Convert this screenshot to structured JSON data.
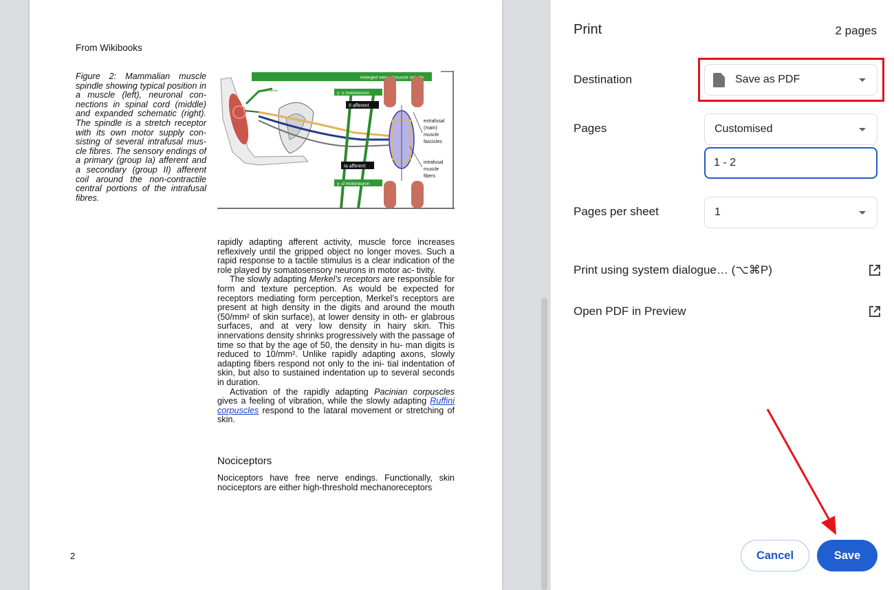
{
  "document": {
    "header": "From Wikibooks",
    "caption": "Figure 2: Mammalian muscle spindle showing typical position in a muscle (left), neuronal con- nections in spinal cord (middle) and expanded schematic (right). The spindle is a stretch receptor with its own motor supply con- sisting of several intrafusal mus- cle fibres. The sensory endings of a primary (group Ia) afferent and a secondary (group II) afferent coil around the non-contractile central portions of the intrafusal fibres.",
    "figure_labels": {
      "top_banner": "enlarged view of muscle spindle",
      "gamma_s": "γ -s motoneuron",
      "ii_afferent": "II afferent",
      "ia_afferent": "Ia afferent",
      "gamma_d": "γ -d motoneuron",
      "extrafusal": [
        "extrafusal",
        "(main)",
        "muscle",
        "fascicles"
      ],
      "intrafusal": [
        "intrafusal",
        "muscle",
        "fibers"
      ],
      "muscle_spindle": "muscle spindle"
    },
    "para1": "rapidly adapting afferent activity, muscle force increases reflexively until the gripped object no longer moves. Such a rapid response to a tactile stimulus is a clear indication of the role played by somatosensory neurons in motor ac- tivity.",
    "para2_before": "The slowly adapting ",
    "para2_italic": "Merkel’s receptors",
    "para2_after": " are responsible for form and texture perception. As would be expected for receptors mediating form perception, Merkel’s receptors are present at high density in the digits and around the mouth (50/mm² of skin surface), at lower density in oth- er glabrous surfaces, and at very low density in hairy skin. This innervations density shrinks progressively with the passage of time so that by the age of 50, the density in hu- man digits is reduced to 10/mm². Unlike rapidly adapting axons, slowly adapting fibers respond not only to the ini- tial indentation of skin, but also to sustained indentation up to several seconds in duration.",
    "para3_before": "Activation of the rapidly adapting ",
    "para3_italic": "Pacinian corpuscles",
    "para3_mid": " gives a feeling of vibration, while the slowly adapting ",
    "para3_link": "Ruffini corpuscles",
    "para3_after": " respond to the lataral movement or stretching of skin.",
    "section_heading": "Nociceptors",
    "section_text": "Nociceptors have free nerve endings. Functionally, skin nociceptors are either high-threshold mechanoreceptors",
    "page_number": "2"
  },
  "panel": {
    "title": "Print",
    "page_count": "2 pages",
    "destination_label": "Destination",
    "destination_value": "Save as PDF",
    "pages_label": "Pages",
    "pages_value": "Customised",
    "pages_range": "1 - 2",
    "pages_per_sheet_label": "Pages per sheet",
    "pages_per_sheet_value": "1",
    "system_dialogue": "Print using system dialogue… (⌥⌘P)",
    "open_pdf": "Open PDF in Preview",
    "cancel": "Cancel",
    "save": "Save"
  },
  "colors": {
    "accent": "#1f5fcf",
    "highlight": "#e0121c",
    "annotation_arrow": "#e5141c"
  },
  "icons": [
    "pdf-file-icon",
    "dropdown-caret-icon",
    "open-external-icon"
  ]
}
